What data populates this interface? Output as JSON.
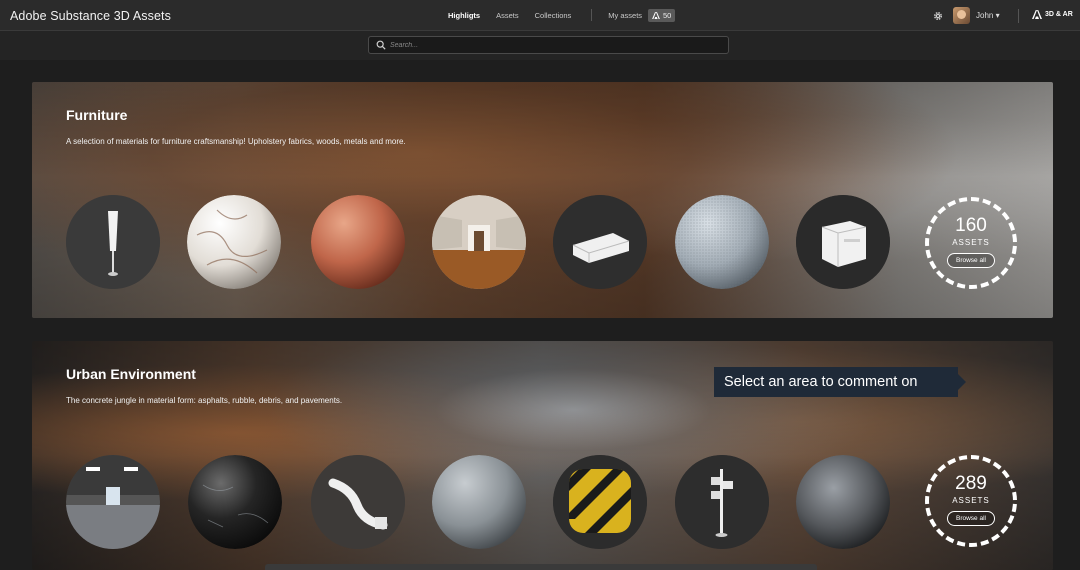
{
  "header": {
    "app_title": "Adobe Substance 3D Assets",
    "nav": [
      "Highligts",
      "Assets",
      "Collections"
    ],
    "my_assets": "My assets",
    "badge_count": "50",
    "user_name": "John",
    "adobe_label": "3D & AR"
  },
  "search": {
    "placeholder": "Search..."
  },
  "categories": [
    {
      "title": "Furniture",
      "description": "A selection of materials for furniture craftsmanship! Upholstery fabrics, woods, metals and more.",
      "count": "160",
      "count_label": "ASSETS",
      "browse": "Browse all",
      "items": [
        "lamp-model",
        "marble-material",
        "terracotta-material",
        "room-environment",
        "sofa-model",
        "fabric-material",
        "nightstand-model"
      ]
    },
    {
      "title": "Urban Environment",
      "description": "The concrete jungle in material form: asphalts, rubble, debris, and pavements.",
      "count": "289",
      "count_label": "ASSETS",
      "browse": "Browse all",
      "items": [
        "parking-environment",
        "dark-stone-material",
        "pipe-model",
        "concrete-material",
        "hazard-stripes-material",
        "signpost-model",
        "chrome-environment"
      ]
    }
  ],
  "tooltip": "Select an area to comment on",
  "colors": {
    "topbar": "#2b2b2b",
    "page": "#1e1e1e",
    "tooltip": "#1f2a38"
  }
}
